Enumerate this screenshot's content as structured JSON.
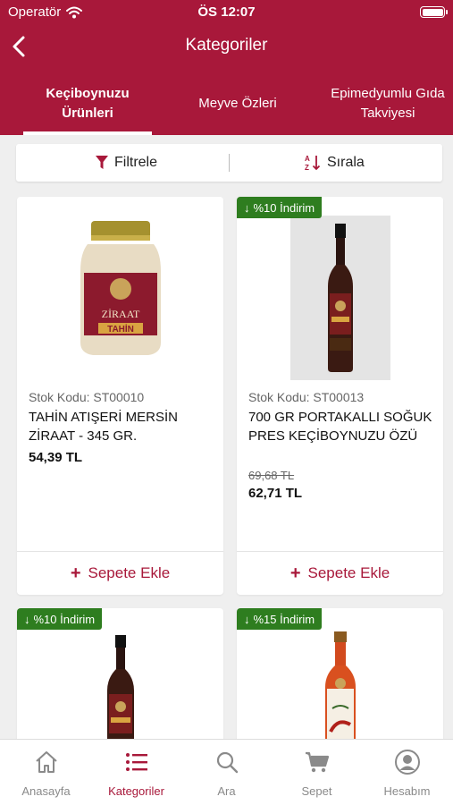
{
  "status_bar": {
    "carrier": "Operatör",
    "time": "ÖS 12:07"
  },
  "nav": {
    "title": "Kategoriler",
    "back_icon": "chevron-left-icon"
  },
  "tabs": [
    {
      "line1": "Keçiboynuzu",
      "line2": "Ürünleri",
      "active": true
    },
    {
      "line1": "Meyve Özleri",
      "line2": "",
      "active": false
    },
    {
      "line1": "Epimedyumlu Gıda",
      "line2": "Takviyesi",
      "active": false
    }
  ],
  "toolbar": {
    "filter_label": "Filtrele",
    "sort_label": "Sırala"
  },
  "products": [
    {
      "badge": "",
      "stock": "Stok Kodu: ST00010",
      "name": "TAHİN ATIŞERİ MERSİN ZİRAAT - 345 GR.",
      "old_price": "",
      "price": "54,39 TL",
      "add_label": "Sepete Ekle",
      "image": "tahini-jar"
    },
    {
      "badge": "%10 İndirim",
      "stock": "Stok Kodu: ST00013",
      "name": "700 GR PORTAKALLI SOĞUK PRES KEÇİBOYNUZU ÖZÜ",
      "old_price": "69,68 TL",
      "price": "62,71 TL",
      "add_label": "Sepete Ekle",
      "image": "dark-bottle"
    },
    {
      "badge": "%10 İndirim",
      "image": "dark-bottle"
    },
    {
      "badge": "%15 İndirim",
      "image": "red-sauce-bottle"
    }
  ],
  "bottom_nav": [
    {
      "label": "Anasayfa",
      "icon": "home-icon",
      "active": false
    },
    {
      "label": "Kategoriler",
      "icon": "list-icon",
      "active": true
    },
    {
      "label": "Ara",
      "icon": "search-icon",
      "active": false
    },
    {
      "label": "Sepet",
      "icon": "cart-icon",
      "active": false
    },
    {
      "label": "Hesabım",
      "icon": "account-icon",
      "active": false
    }
  ],
  "colors": {
    "brand": "#a8183a",
    "badge": "#2e7d1f",
    "background": "#efefef"
  }
}
